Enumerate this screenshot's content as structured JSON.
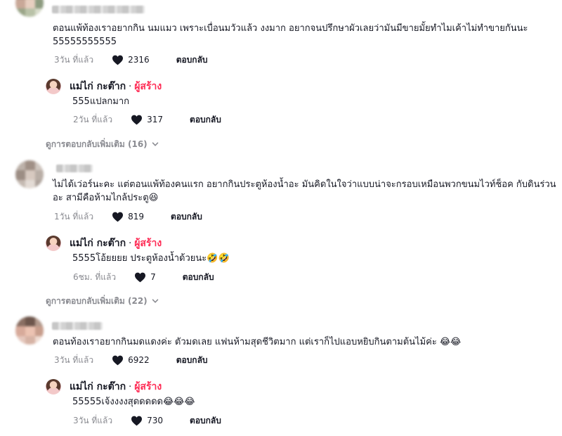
{
  "comments": [
    {
      "text": "ตอนแพ้ท้องเราอยากกิน นมแมว เพราะเบื่อนมวัวแล้ว งงมาก อยากจนปรึกษาผัวเลยว่ามันมีขายมั้ยทำไมเค้าไม่ทำขายกันนะ 55555555555",
      "time": "3วัน ที่แล้ว",
      "likes": "2316",
      "reply_label": "ตอบกลับ",
      "creator_reply": {
        "name": "แม่ไก่ กะต๊าก",
        "dot": "·",
        "tag": "ผู้สร้าง",
        "text": "555แปลกมาก",
        "time": "2วัน ที่แล้ว",
        "likes": "317",
        "reply_label": "ตอบกลับ"
      },
      "more_replies": "ดูการตอบกลับเพิ่มเติม (16)"
    },
    {
      "text": "ไม่ได้เว่อร์นะคะ แต่ตอนแพ้ท้องคนแรก อยากกินประตูห้องน้ำอะ มันคิดในใจว่าแบบน่าจะกรอบเหมือนพวกขนมไวท์ช็อค กับดินร่วนอะ สามีคือห้ามไกล้ประตู😆",
      "time": "1วัน ที่แล้ว",
      "likes": "819",
      "reply_label": "ตอบกลับ",
      "creator_reply": {
        "name": "แม่ไก่ กะต๊าก",
        "dot": "·",
        "tag": "ผู้สร้าง",
        "text": "5555โอ้ยยยย ประตูห้องน้ำด้วยนะ🤣🤣",
        "time": "6ชม. ที่แล้ว",
        "likes": "7",
        "reply_label": "ตอบกลับ"
      },
      "more_replies": "ดูการตอบกลับเพิ่มเติม (22)"
    },
    {
      "text": "ตอนท้องเราอยากกินมดแดงค่ะ ตัวมดเลย แฟนห้ามสุดชีวิตมาก แต่เราก็ไปแอบหยิบกินตามต้นไม้ค่ะ 😂😂",
      "time": "3วัน ที่แล้ว",
      "likes": "6922",
      "reply_label": "ตอบกลับ",
      "creator_reply": {
        "name": "แม่ไก่ กะต๊าก",
        "dot": "·",
        "tag": "ผู้สร้าง",
        "text": "55555เจ้งงงงสุดดดดด😂😂😂",
        "time": "3วัน ที่แล้ว",
        "likes": "730",
        "reply_label": "ตอบกลับ"
      }
    }
  ],
  "colors": {
    "creator_tag": "#fe2c55",
    "text": "#161823",
    "meta": "#8a8b91"
  },
  "icons": {
    "like": "heart-icon",
    "expand": "chevron-down-icon"
  }
}
